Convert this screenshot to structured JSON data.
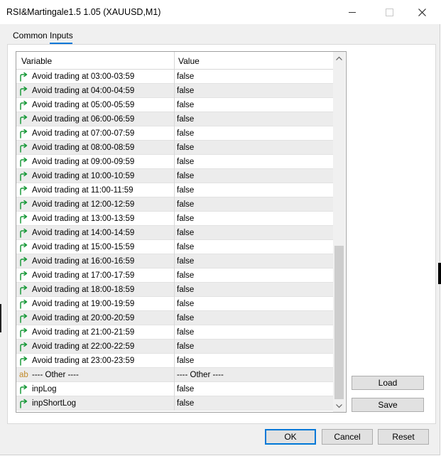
{
  "window": {
    "title": "RSI&Martingale1.5 1.05 (XAUUSD,M1)"
  },
  "tabs": [
    {
      "label": "Common",
      "active": false
    },
    {
      "label": "Inputs",
      "active": true
    }
  ],
  "grid": {
    "headers": {
      "variable": "Variable",
      "value": "Value"
    },
    "rows": [
      {
        "icon": "arrow",
        "variable": "Avoid trading at 03:00-03:59",
        "value": "false"
      },
      {
        "icon": "arrow",
        "variable": "Avoid trading at 04:00-04:59",
        "value": "false"
      },
      {
        "icon": "arrow",
        "variable": "Avoid trading at 05:00-05:59",
        "value": "false"
      },
      {
        "icon": "arrow",
        "variable": "Avoid trading at 06:00-06:59",
        "value": "false"
      },
      {
        "icon": "arrow",
        "variable": "Avoid trading at 07:00-07:59",
        "value": "false"
      },
      {
        "icon": "arrow",
        "variable": "Avoid trading at 08:00-08:59",
        "value": "false"
      },
      {
        "icon": "arrow",
        "variable": "Avoid trading at 09:00-09:59",
        "value": "false"
      },
      {
        "icon": "arrow",
        "variable": "Avoid trading at 10:00-10:59",
        "value": "false"
      },
      {
        "icon": "arrow",
        "variable": "Avoid trading at 11:00-11:59",
        "value": "false"
      },
      {
        "icon": "arrow",
        "variable": "Avoid trading at 12:00-12:59",
        "value": "false"
      },
      {
        "icon": "arrow",
        "variable": "Avoid trading at 13:00-13:59",
        "value": "false"
      },
      {
        "icon": "arrow",
        "variable": "Avoid trading at 14:00-14:59",
        "value": "false"
      },
      {
        "icon": "arrow",
        "variable": "Avoid trading at 15:00-15:59",
        "value": "false"
      },
      {
        "icon": "arrow",
        "variable": "Avoid trading at 16:00-16:59",
        "value": "false"
      },
      {
        "icon": "arrow",
        "variable": "Avoid trading at 17:00-17:59",
        "value": "false"
      },
      {
        "icon": "arrow",
        "variable": "Avoid trading at 18:00-18:59",
        "value": "false"
      },
      {
        "icon": "arrow",
        "variable": "Avoid trading at 19:00-19:59",
        "value": "false"
      },
      {
        "icon": "arrow",
        "variable": "Avoid trading at 20:00-20:59",
        "value": "false"
      },
      {
        "icon": "arrow",
        "variable": "Avoid trading at 21:00-21:59",
        "value": "false"
      },
      {
        "icon": "arrow",
        "variable": "Avoid trading at 22:00-22:59",
        "value": "false"
      },
      {
        "icon": "arrow",
        "variable": "Avoid trading at 23:00-23:59",
        "value": "false"
      },
      {
        "icon": "ab",
        "icon_text": "ab",
        "variable": "---- Other ----",
        "value": "---- Other ----"
      },
      {
        "icon": "arrow",
        "variable": "inpLog",
        "value": "false"
      },
      {
        "icon": "arrow",
        "variable": "inpShortLog",
        "value": "false"
      }
    ]
  },
  "side_buttons": {
    "load": "Load",
    "save": "Save"
  },
  "footer_buttons": {
    "ok": "OK",
    "cancel": "Cancel",
    "reset": "Reset"
  },
  "colors": {
    "accent": "#0078d7",
    "arrow_icon": "#1a9a3a",
    "ab_icon": "#c08a2a"
  }
}
